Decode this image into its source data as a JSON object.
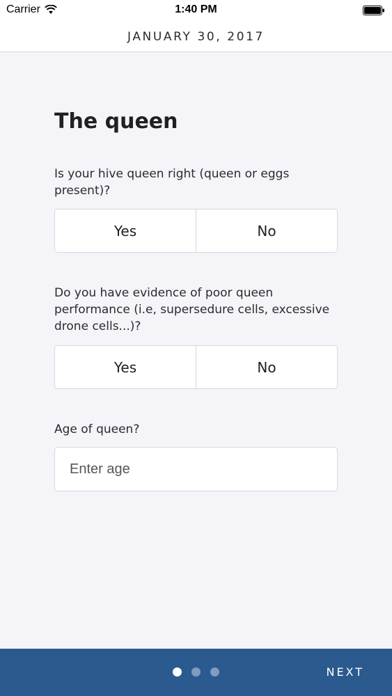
{
  "status_bar": {
    "carrier": "Carrier",
    "time": "1:40 PM"
  },
  "header": {
    "date": "JANUARY 30, 2017"
  },
  "section": {
    "title": "The queen"
  },
  "questions": [
    {
      "text": "Is your hive queen right (queen or eggs present)?",
      "options": [
        "Yes",
        "No"
      ]
    },
    {
      "text": "Do you have evidence of poor queen performance (i.e, supersedure cells, excessive drone cells...)?",
      "options": [
        "Yes",
        "No"
      ]
    },
    {
      "text": "Age of queen?",
      "placeholder": "Enter age",
      "value": ""
    }
  ],
  "footer": {
    "next_label": "NEXT",
    "page_count": 3,
    "current_page": 1,
    "background_color": "#2b5a8e"
  },
  "icons": {
    "wifi": "wifi-icon",
    "battery": "battery-icon"
  }
}
